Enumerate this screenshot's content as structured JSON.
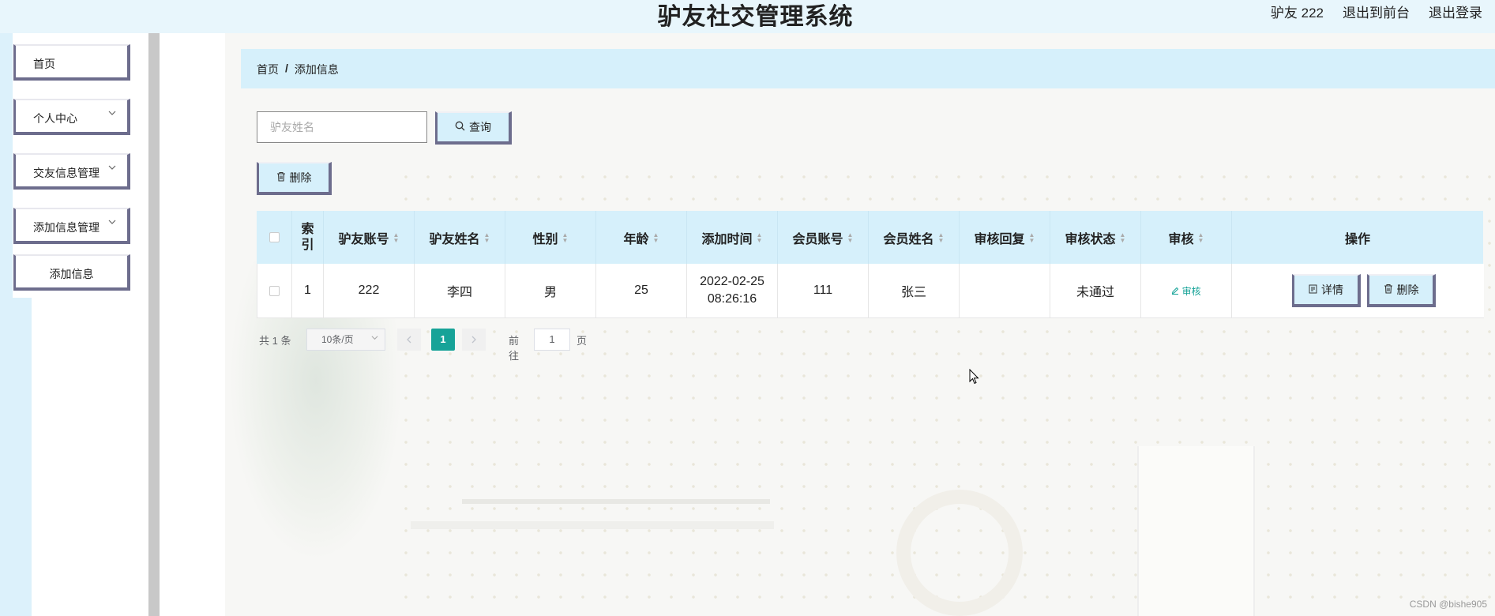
{
  "header": {
    "title": "驴友社交管理系统",
    "user": "驴友 222",
    "back_front": "退出到前台",
    "logout": "退出登录"
  },
  "sidebar": {
    "items": [
      {
        "label": "首页",
        "has_arrow": false
      },
      {
        "label": "个人中心",
        "has_arrow": true
      },
      {
        "label": "交友信息管理",
        "has_arrow": true
      },
      {
        "label": "添加信息管理",
        "has_arrow": true
      },
      {
        "label": "添加信息",
        "has_arrow": false
      }
    ]
  },
  "breadcrumb": {
    "home": "首页",
    "separator": "/",
    "current": "添加信息"
  },
  "search": {
    "placeholder": "驴友姓名",
    "button": "查询"
  },
  "toolbar": {
    "delete": "删除"
  },
  "table": {
    "columns": [
      "索引",
      "驴友账号",
      "驴友姓名",
      "性别",
      "年龄",
      "添加时间",
      "会员账号",
      "会员姓名",
      "审核回复",
      "审核状态",
      "审核",
      "操作"
    ],
    "rows": [
      {
        "index": "1",
        "account": "222",
        "name": "李四",
        "gender": "男",
        "age": "25",
        "added_date": "2022-02-25",
        "added_time": "08:26:16",
        "member_account": "111",
        "member_name": "张三",
        "audit_reply": "",
        "audit_status": "未通过",
        "audit_link": "审核",
        "detail_button": "详情",
        "delete_button": "删除"
      }
    ]
  },
  "pagination": {
    "total": "共 1 条",
    "page_size": "10条/页",
    "current_page": "1",
    "goto_label": "前往",
    "goto_value": "1",
    "page_suffix": "页"
  },
  "watermark": "CSDN @bishe905",
  "colors": {
    "accent": "#17a398",
    "panel": "#d6f0fb",
    "border": "#6d6d8d"
  }
}
